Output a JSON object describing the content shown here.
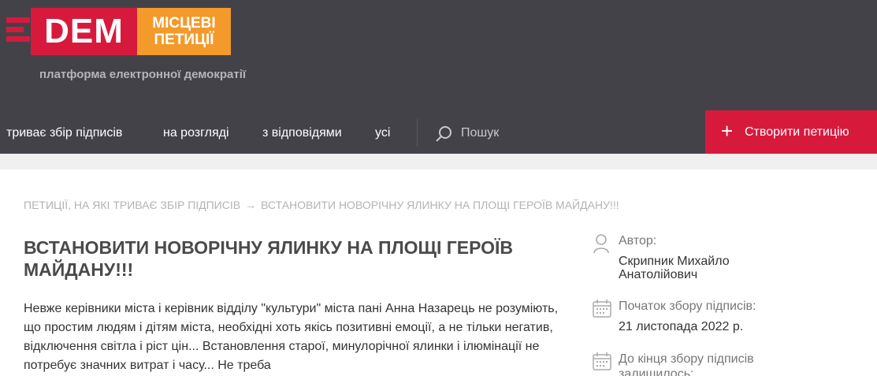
{
  "logo": {
    "dem": "DEM",
    "local_line1": "МІСЦЕВІ",
    "local_line2": "ПЕТИЦІЇ",
    "tagline": "платформа електронної демократії"
  },
  "nav": {
    "items": [
      "триває збір підписів",
      "на розгляді",
      "з відповідями",
      "усі"
    ],
    "search_label": "Пошук",
    "create_label": "Створити петицію"
  },
  "breadcrumb": {
    "parent": "Петиції, на які триває збір підписів",
    "separator": "→",
    "current": "Встановити новорічну ялинку на площі героїв майдану!!!"
  },
  "petition": {
    "title": "ВСТАНОВИТИ НОВОРІЧНУ ЯЛИНКУ НА ПЛОЩІ ГЕРОЇВ МАЙДАНУ!!!",
    "body": "Невже керівники міста і керівник відділу \"культури\" міста пані Анна Назарець не розуміють, що простим людям і дітям міста, необхідні хоть якісь позитивні емоції, а не тільки негатив, відключення світла і ріст цін... Встановлення старої, минулорічної ялинки і ілюмінації не потребує значних витрат і часу... Не треба"
  },
  "sidebar": {
    "author_label": "Автор:",
    "author_line1": "Скрипник Михайло",
    "author_line2": "Анатолійович",
    "start_label": "Початок збору підписів:",
    "start_value": "21 листопада 2022 р.",
    "end_label_line1": "До кінця збору підписів",
    "end_label_line2": "залишилось:"
  },
  "colors": {
    "header": "#434249",
    "accent_red": "#d71a3c",
    "accent_orange": "#f39a2b"
  }
}
